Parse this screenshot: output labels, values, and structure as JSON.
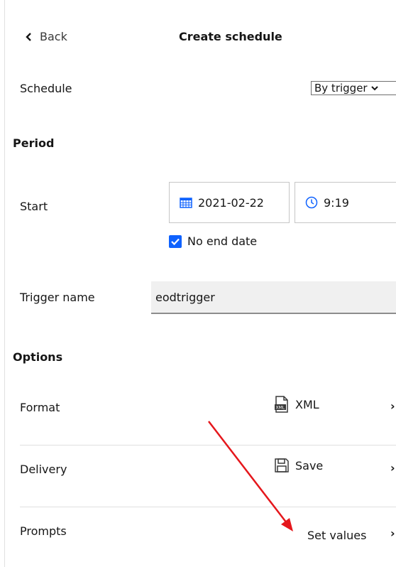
{
  "header": {
    "back_label": "Back",
    "title": "Create schedule"
  },
  "schedule": {
    "label": "Schedule",
    "selected": "By trigger"
  },
  "period": {
    "heading": "Period",
    "start_label": "Start",
    "date": "2021-02-22",
    "time": "9:19",
    "no_end_label": "No end date",
    "no_end_checked": true
  },
  "trigger": {
    "label": "Trigger name",
    "value": "eodtrigger"
  },
  "options": {
    "heading": "Options",
    "format_label": "Format",
    "format_value": "XML",
    "delivery_label": "Delivery",
    "delivery_value": "Save",
    "prompts_label": "Prompts",
    "prompts_value": "Set values"
  },
  "colors": {
    "accent": "#0f62fe",
    "annotation_arrow": "#e5171c"
  }
}
